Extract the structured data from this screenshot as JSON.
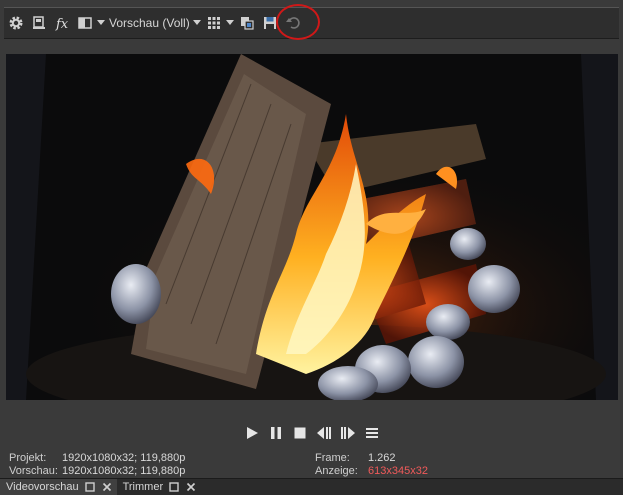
{
  "toolbar": {
    "preview_mode": "Vorschau (Voll)",
    "icons": [
      "gear-icon",
      "video-output-icon",
      "fx-icon",
      "split-screen-icon",
      "chevron-down-icon",
      "grid-icon",
      "chevron-down-icon",
      "copy-frame-icon",
      "save-frame-icon",
      "undo-icon"
    ],
    "annotation_color": "#d01818"
  },
  "transport": {
    "buttons": [
      "play-icon",
      "pause-icon",
      "stop-icon",
      "previous-frame-icon",
      "next-frame-icon",
      "menu-icon"
    ]
  },
  "info": {
    "projekt_label": "Projekt:",
    "projekt_value": "1920x1080x32; 119,880p",
    "vorschau_label": "Vorschau:",
    "vorschau_value": "1920x1080x32; 119,880p",
    "frame_label": "Frame:",
    "frame_value": "1.262",
    "anzeige_label": "Anzeige:",
    "anzeige_value": "613x345x32",
    "anzeige_color": "#f05a5a"
  },
  "tabs": [
    {
      "label": "Videovorschau",
      "active": true
    },
    {
      "label": "Trimmer",
      "active": false
    }
  ]
}
